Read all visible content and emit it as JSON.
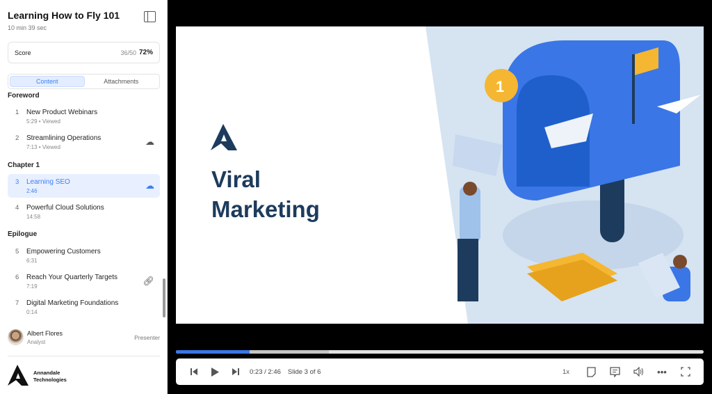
{
  "course": {
    "title": "Learning How to Fly 101",
    "duration": "10 min 39 sec"
  },
  "score": {
    "label": "Score",
    "fraction": "36/50",
    "percent": "72%"
  },
  "tabs": [
    {
      "label": "Content",
      "active": true
    },
    {
      "label": "Attachments",
      "active": false
    }
  ],
  "sections": [
    {
      "title": "Foreword",
      "items": [
        {
          "num": "1",
          "name": "New Product Webinars",
          "meta": "5:29  •  Viewed",
          "icon": ""
        },
        {
          "num": "2",
          "name": "Streamlining Operations",
          "meta": "7:13  •  Viewed",
          "icon": "cloud-download-icon"
        }
      ]
    },
    {
      "title": "Chapter 1",
      "items": [
        {
          "num": "3",
          "name": "Learning SEO",
          "meta": "2:46",
          "icon": "cloud-download-icon",
          "active": true
        },
        {
          "num": "4",
          "name": "Powerful Cloud Solutions",
          "meta": "14:58",
          "icon": ""
        }
      ]
    },
    {
      "title": "Epilogue",
      "items": [
        {
          "num": "5",
          "name": "Empowering Customers",
          "meta": "6:31",
          "icon": ""
        },
        {
          "num": "6",
          "name": "Reach Your Quarterly Targets",
          "meta": "7:19",
          "icon": "link-icon"
        },
        {
          "num": "7",
          "name": "Digital Marketing Foundations",
          "meta": "0:14",
          "icon": ""
        }
      ]
    }
  ],
  "presenter": {
    "name": "Albert Flores",
    "role": "Analyst",
    "label": "Presenter"
  },
  "brand": {
    "line1": "Annandale",
    "line2": "Technologies"
  },
  "slide": {
    "title_line1": "Viral",
    "title_line2": "Marketing",
    "badge": "1"
  },
  "player": {
    "time": "0:23 / 2:46",
    "slide": "Slide 3 of 6",
    "speed": "1x",
    "played_percent": 13.9,
    "buffered_percent": 29,
    "accent": "#3a76e6"
  }
}
